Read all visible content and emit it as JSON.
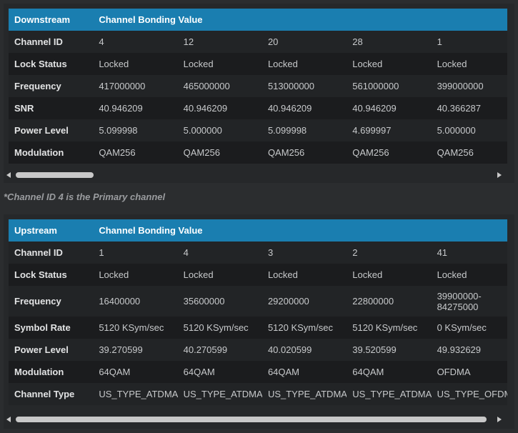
{
  "downstream": {
    "header": [
      "Downstream",
      "Channel Bonding Value"
    ],
    "rows": [
      {
        "label": "Channel ID",
        "values": [
          "4",
          "12",
          "20",
          "28",
          "1"
        ]
      },
      {
        "label": "Lock Status",
        "values": [
          "Locked",
          "Locked",
          "Locked",
          "Locked",
          "Locked"
        ]
      },
      {
        "label": "Frequency",
        "values": [
          "417000000",
          "465000000",
          "513000000",
          "561000000",
          "399000000"
        ]
      },
      {
        "label": "SNR",
        "values": [
          "40.946209",
          "40.946209",
          "40.946209",
          "40.946209",
          "40.366287"
        ]
      },
      {
        "label": "Power Level",
        "values": [
          "5.099998",
          "5.000000",
          "5.099998",
          "4.699997",
          "5.000000"
        ]
      },
      {
        "label": "Modulation",
        "values": [
          "QAM256",
          "QAM256",
          "QAM256",
          "QAM256",
          "QAM256"
        ]
      }
    ]
  },
  "note": "*Channel ID 4 is the Primary channel",
  "upstream": {
    "header": [
      "Upstream",
      "Channel Bonding Value"
    ],
    "rows": [
      {
        "label": "Channel ID",
        "values": [
          "1",
          "4",
          "3",
          "2",
          "41"
        ]
      },
      {
        "label": "Lock Status",
        "values": [
          "Locked",
          "Locked",
          "Locked",
          "Locked",
          "Locked"
        ]
      },
      {
        "label": "Frequency",
        "values": [
          "16400000",
          "35600000",
          "29200000",
          "22800000",
          "39900000-84275000"
        ]
      },
      {
        "label": "Symbol Rate",
        "values": [
          "5120 KSym/sec",
          "5120 KSym/sec",
          "5120 KSym/sec",
          "5120 KSym/sec",
          "0 KSym/sec"
        ]
      },
      {
        "label": "Power Level",
        "values": [
          "39.270599",
          "40.270599",
          "40.020599",
          "39.520599",
          "49.932629"
        ]
      },
      {
        "label": "Modulation",
        "values": [
          "64QAM",
          "64QAM",
          "64QAM",
          "64QAM",
          "OFDMA"
        ]
      },
      {
        "label": "Channel Type",
        "values": [
          "US_TYPE_ATDMA",
          "US_TYPE_ATDMA",
          "US_TYPE_ATDMA",
          "US_TYPE_ATDMA",
          "US_TYPE_OFDMA"
        ]
      }
    ]
  },
  "colors": {
    "header_bg": "#1a7eb0",
    "page_bg": "#2b2d2f"
  },
  "icons": {
    "scroll_left": "triangle-left-icon",
    "scroll_right": "triangle-right-icon"
  }
}
